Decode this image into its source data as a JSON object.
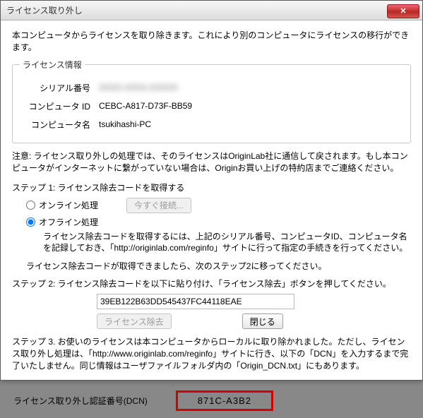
{
  "window": {
    "title": "ライセンス取り外し"
  },
  "intro": "本コンピュータからライセンスを取り除きます。これにより別のコンピュータにライセンスの移行ができます。",
  "license_info": {
    "legend": "ライセンス情報",
    "serial_label": "シリアル番号",
    "serial_value": "XXXX-XXXX-XXXXX",
    "computer_id_label": "コンピュータ ID",
    "computer_id_value": "CEBC-A817-D73F-BB59",
    "computer_name_label": "コンピュータ名",
    "computer_name_value": "tsukihashi-PC"
  },
  "notice": "注意: ライセンス取り外しの処理では、そのライセンスはOriginLab社に通信して戻されます。もし本コンピュータがインターネットに繋がっていない場合は、Originお買い上げの特約店までご連絡ください。",
  "step1": {
    "title": "ステップ 1: ライセンス除去コードを取得する",
    "online_label": "オンライン処理",
    "connect_btn": "今すぐ接続...",
    "offline_label": "オフライン処理",
    "offline_desc": "ライセンス除去コードを取得するには、上記のシリアル番号、コンピュータID、コンピュータ名を記録しておき、「http://originlab.com/reginfo」サイトに行って指定の手続きを行ってください。"
  },
  "step2_note": "ライセンス除去コードが取得できましたら、次のステップ2に移ってください。",
  "step2": {
    "title": "ステップ 2: ライセンス除去コードを以下に貼り付け、「ライセンス除去」ボタンを押してください。",
    "code_value": "39EB122B63DD545437FC44118EAE",
    "remove_btn": "ライセンス除去",
    "close_btn": "閉じる"
  },
  "step3": {
    "text": "ステップ 3. お使いのライセンスは本コンピュータからローカルに取り除かれました。ただし、ライセンス取り外し処理は、「http://www.originlab.com/reginfo」サイトに行き、以下の「DCN」を入力するまで完了いたしません。同じ情報はユーザファイルフォルダ内の「Origin_DCN.txt」にもあります。"
  },
  "dcn": {
    "label": "ライセンス取り外し認証番号(DCN)",
    "value": "871C-A3B2"
  }
}
